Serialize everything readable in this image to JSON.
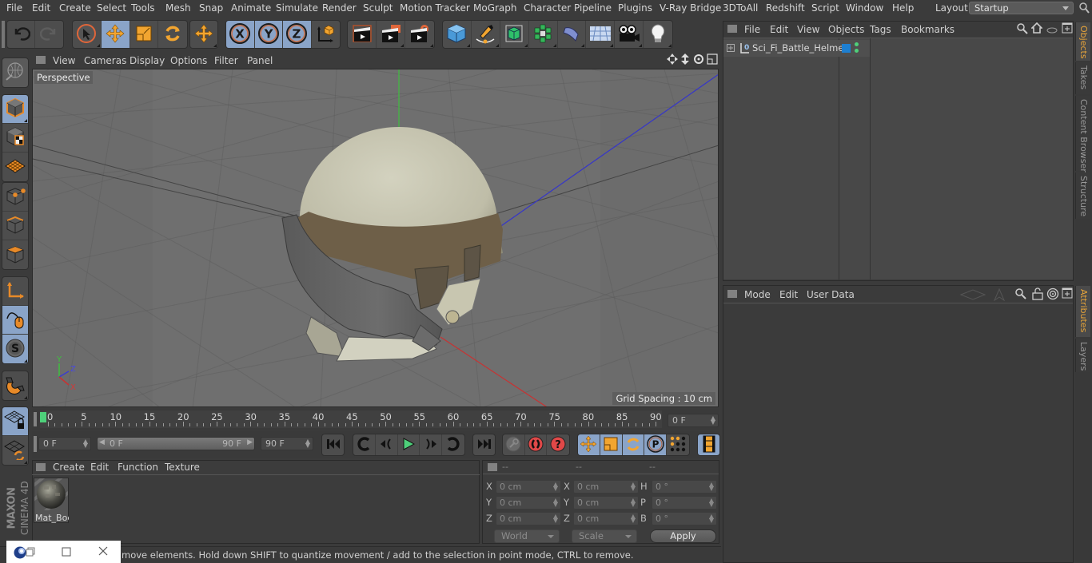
{
  "menubar": {
    "items": [
      "File",
      "Edit",
      "Create",
      "Select",
      "Tools",
      "Mesh",
      "Snap",
      "Animate",
      "Simulate",
      "Render",
      "Sculpt",
      "Motion Tracker",
      "MoGraph",
      "Character",
      "Pipeline",
      "Plugins",
      "V-Ray Bridge",
      "3DToAll",
      "Redshift",
      "Script",
      "Window",
      "Help"
    ],
    "layout_label": "Layout:",
    "layout_value": "Startup"
  },
  "toolbar": {
    "groups": [
      {
        "name": "history",
        "items": [
          {
            "icon": "undo-icon",
            "active": false
          },
          {
            "icon": "redo-icon",
            "active": false
          }
        ]
      },
      {
        "name": "tools",
        "items": [
          {
            "icon": "live-selection-icon",
            "active": false
          },
          {
            "icon": "move-icon",
            "active": true
          },
          {
            "icon": "scale-icon",
            "active": false
          },
          {
            "icon": "rotate-icon",
            "active": false
          }
        ]
      },
      {
        "name": "recent",
        "items": [
          {
            "icon": "recent-tool-move-icon",
            "active": false
          }
        ]
      },
      {
        "name": "axis",
        "items": [
          {
            "icon": "x-axis-icon",
            "active": true
          },
          {
            "icon": "y-axis-icon",
            "active": true
          },
          {
            "icon": "z-axis-icon",
            "active": true
          },
          {
            "icon": "coordinate-system-icon",
            "active": false
          }
        ]
      },
      {
        "name": "render",
        "items": [
          {
            "icon": "render-view-icon",
            "active": false
          },
          {
            "icon": "render-picture-viewer-icon",
            "active": false
          },
          {
            "icon": "render-settings-icon",
            "active": false
          }
        ]
      },
      {
        "name": "create",
        "items": [
          {
            "icon": "cube-icon",
            "active": false
          },
          {
            "icon": "pen-spline-icon",
            "active": false
          },
          {
            "icon": "subdivision-surface-icon",
            "active": false
          },
          {
            "icon": "cloner-icon",
            "active": false
          },
          {
            "icon": "bend-deformer-icon",
            "active": false
          },
          {
            "icon": "floor-icon",
            "active": false
          },
          {
            "icon": "camera-icon",
            "active": false
          },
          {
            "icon": "light-icon",
            "active": false
          }
        ]
      }
    ]
  },
  "left_palette": {
    "items": [
      "make-editable-icon",
      "model-mode-icon",
      "texture-mode-icon",
      "workplane-mode-icon",
      "points-mode-icon",
      "edges-mode-icon",
      "polygons-mode-icon",
      "axis-mode-icon",
      "tweak-mode-icon",
      "solo-icon",
      "snap-icon",
      "workplane-lock-icon",
      "workplane-align-icon"
    ]
  },
  "viewport": {
    "menu": [
      "View",
      "Cameras",
      "Display",
      "Options",
      "Filter",
      "Panel"
    ],
    "camera_label": "Perspective",
    "grid_spacing": "Grid Spacing : 10 cm",
    "axis_labels": {
      "x": "X",
      "y": "Y",
      "z": "Z"
    },
    "object": "Sci_Fi_Battle_Helmet"
  },
  "timeline": {
    "ticks": [
      "0",
      "5",
      "10",
      "15",
      "20",
      "25",
      "30",
      "35",
      "40",
      "45",
      "50",
      "55",
      "60",
      "65",
      "70",
      "75",
      "80",
      "85",
      "90"
    ],
    "current_frame": "0 F",
    "start_field": "0 F",
    "range_start": "0 F",
    "range_end": "90 F",
    "end_field": "90 F"
  },
  "materials": {
    "menu": [
      "Create",
      "Edit",
      "Function",
      "Texture"
    ],
    "items": [
      {
        "name": "Mat_Bod"
      }
    ]
  },
  "coordinates": {
    "headers": [
      "--",
      "--",
      "--"
    ],
    "rows": [
      {
        "l1": "X",
        "v1": "0 cm",
        "l2": "X",
        "v2": "0 cm",
        "l3": "H",
        "v3": "0 °"
      },
      {
        "l1": "Y",
        "v1": "0 cm",
        "l2": "Y",
        "v2": "0 cm",
        "l3": "P",
        "v3": "0 °"
      },
      {
        "l1": "Z",
        "v1": "0 cm",
        "l2": "Z",
        "v2": "0 cm",
        "l3": "B",
        "v3": "0 °"
      }
    ],
    "space": "World",
    "mode": "Scale",
    "apply": "Apply"
  },
  "object_manager": {
    "menu": [
      "File",
      "Edit",
      "View",
      "Objects",
      "Tags",
      "Bookmarks"
    ],
    "objects": [
      {
        "name": "Sci_Fi_Battle_Helmet",
        "layer_color": "#1e7fd0"
      }
    ]
  },
  "attributes": {
    "menu": [
      "Mode",
      "Edit",
      "User Data"
    ]
  },
  "right_tabs": {
    "top": [
      {
        "label": "Objects",
        "active": true
      },
      {
        "label": "Takes",
        "active": false
      },
      {
        "label": "Content Browser",
        "active": false
      },
      {
        "label": "Structure",
        "active": false
      }
    ],
    "bottom": [
      {
        "label": "Attributes",
        "active": true
      },
      {
        "label": "Layers",
        "active": false
      }
    ]
  },
  "branding": {
    "maxon": "MAXON",
    "product": "CINEMA 4D"
  },
  "status_bar": {
    "text": "move elements. Hold down SHIFT to quantize movement / add to the selection in point mode, CTRL to remove."
  },
  "colors": {
    "accent_active": "#8aa4c8",
    "tab_active_text": "#e7a43a",
    "icon_orange": "#f2a530"
  }
}
